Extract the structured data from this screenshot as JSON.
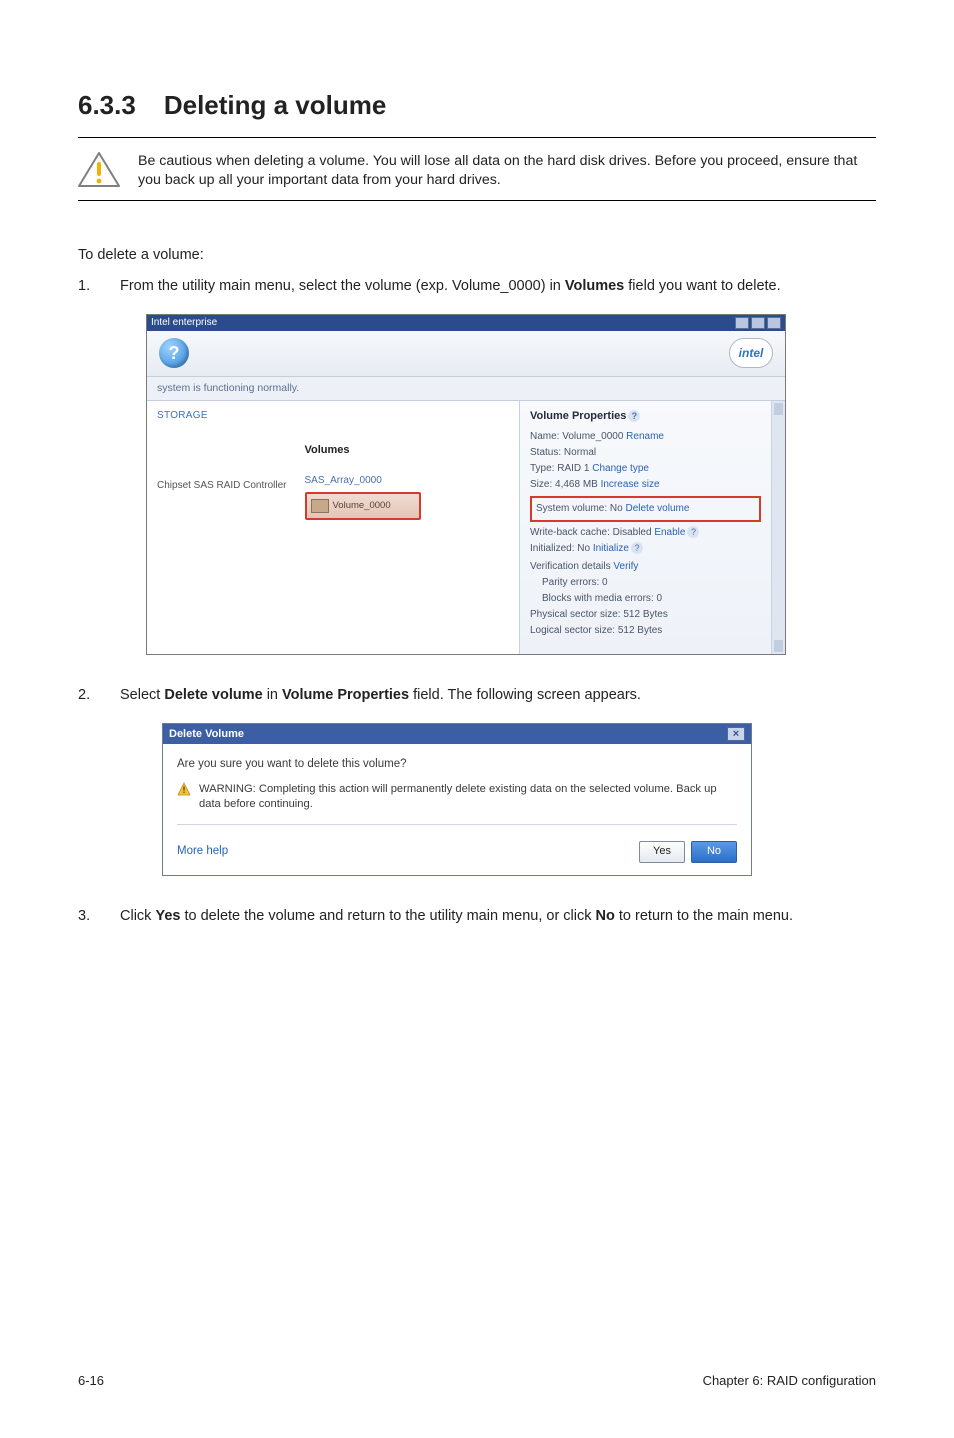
{
  "section": {
    "number": "6.3.3",
    "title": "Deleting a volume"
  },
  "caution": "Be cautious when deleting a volume. You will lose all data on the hard disk drives. Before you proceed, ensure that you back up all your important data from your hard drives.",
  "intro": "To delete a volume:",
  "steps": {
    "one_num": "1.",
    "one_a": "From the utility main menu, select the volume (exp. Volume_0000) in ",
    "one_bold": "Volumes",
    "one_b": " field you want to delete.",
    "two_num": "2.",
    "two_a": "Select ",
    "two_bold1": "Delete volume",
    "two_mid": " in ",
    "two_bold2": "Volume Properties",
    "two_b": " field. The following screen appears.",
    "three_num": "3.",
    "three_a": "Click ",
    "three_bold1": "Yes",
    "three_mid": " to delete the volume and return to the utility main menu, or click ",
    "three_bold2": "No",
    "three_b": " to return to the main menu."
  },
  "rst": {
    "window_title": "Intel enterprise",
    "status": "system is functioning normally.",
    "storage_label": "STORAGE",
    "toolbar_intel": "intel",
    "controller": "Chipset SAS RAID Controller",
    "volumes_header": "Volumes",
    "array_label": "SAS_Array_0000",
    "volume_chip": "Volume_0000",
    "props": {
      "header": "Volume Properties",
      "name_label": "Name: Volume_0000 ",
      "name_action": "Rename",
      "status": "Status: Normal",
      "type_label": "Type: RAID 1 ",
      "type_action": "Change type",
      "size_label": "Size: 4,468 MB ",
      "size_action": "Increase size",
      "system_label": "System volume: No ",
      "system_action": "Delete volume",
      "wbcache_label": "Write-back cache: Disabled ",
      "wbcache_action": "Enable",
      "initialized_label": "Initialized: No ",
      "initialized_action": "Initialize",
      "verif_label": "Verification details ",
      "verif_action": "Verify",
      "parity": "Parity errors: 0",
      "blocks": "Blocks with media errors: 0",
      "phys": "Physical sector size: 512 Bytes",
      "logi": "Logical sector size: 512 Bytes"
    }
  },
  "dialog": {
    "title": "Delete Volume",
    "prompt": "Are you sure you want to delete this volume?",
    "warning": "WARNING: Completing this action will permanently delete existing data on the selected volume. Back up data before continuing.",
    "more_help": "More help",
    "yes": "Yes",
    "no": "No"
  },
  "footer": {
    "left": "6-16",
    "right": "Chapter 6: RAID configuration"
  }
}
